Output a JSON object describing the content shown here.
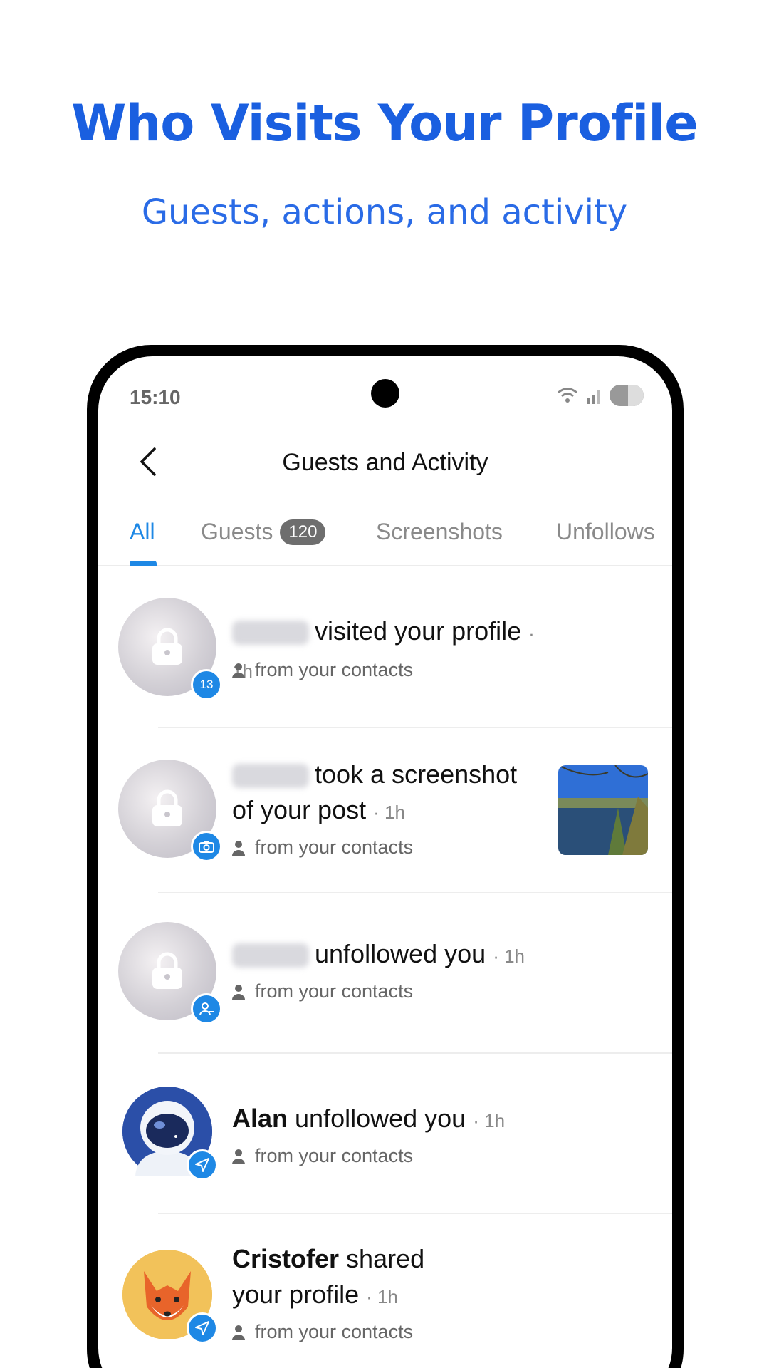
{
  "hero": {
    "title": "Who Visits Your Profile",
    "subtitle": "Guests, actions, and activity"
  },
  "status_bar": {
    "time": "15:10"
  },
  "header": {
    "title": "Guests and Activity"
  },
  "tabs": [
    {
      "label": "All",
      "active": true
    },
    {
      "label": "Guests",
      "badge": "120"
    },
    {
      "label": "Screenshots"
    },
    {
      "label": "Unfollows"
    }
  ],
  "items": [
    {
      "name": "",
      "action": "visited your profile",
      "time": "1h",
      "source": "from your contacts",
      "badge": "13",
      "badge_icon": "count-badge"
    },
    {
      "name": "",
      "action": "took a screenshot",
      "action2": "of your post",
      "time": "1h",
      "source": "from your contacts",
      "badge_icon": "camera-icon",
      "thumbnail": "lake-forest-photo"
    },
    {
      "name": "",
      "action": "unfollowed you",
      "time": "1h",
      "source": "from your contacts",
      "badge_icon": "user-minus-icon"
    },
    {
      "name": "Alan",
      "action": "unfollowed you",
      "time": "1h",
      "source": "from your contacts",
      "badge_icon": "send-icon",
      "avatar": "astronaut-avatar"
    },
    {
      "name": "Cristofer",
      "action": "shared",
      "action2": "your profile",
      "time": "1h",
      "source": "from your contacts",
      "badge_icon": "send-icon",
      "avatar": "fox-avatar"
    }
  ],
  "colors": {
    "brand": "#1a5fe0",
    "accent": "#1e88e5"
  }
}
